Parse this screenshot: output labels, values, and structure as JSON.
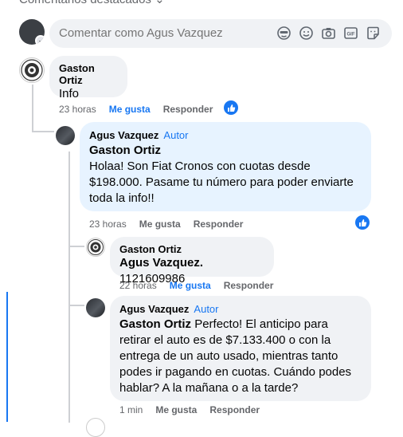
{
  "section": {
    "title": "Comentarios destacados"
  },
  "composer": {
    "placeholder": "Comentar como Agus Vazquez",
    "icons": [
      "avatar-sticker-icon",
      "emoji-icon",
      "camera-icon",
      "gif-icon",
      "sticker-icon"
    ]
  },
  "comments": [
    {
      "author": "Gaston Ortiz",
      "text": "Info",
      "time": "23 horas",
      "like": "Me gusta",
      "reply": "Responder",
      "avatar": "logo"
    },
    {
      "author": "Agus Vazquez",
      "author_tag": "Autor",
      "mention": "Gaston Ortiz",
      "text": "Holaa! Son Fiat Cronos con cuotas desde $198.000. Pasame tu número para poder enviarte toda la info!!",
      "time": "23 horas",
      "like": "Me gusta",
      "reply": "Responder",
      "avatar": "dark"
    },
    {
      "author": "Gaston Ortiz",
      "mention": "Agus Vazquez.",
      "text": "1121609986",
      "time": "22 horas",
      "like": "Me gusta",
      "reply": "Responder",
      "avatar": "logo"
    },
    {
      "author": "Agus Vazquez",
      "author_tag": "Autor",
      "mention": "Gaston Ortiz",
      "text": "Perfecto! El anticipo para retirar el auto es de $7.133.400 o con la entrega de un auto usado, mientras tanto podes ir pagando en cuotas. Cuándo podes hablar? A la mañana o a la tarde?",
      "time": "1 min",
      "like": "Me gusta",
      "reply": "Responder",
      "avatar": "dark"
    }
  ],
  "colors": {
    "accent": "#1877f2",
    "bubble": "#f0f2f5",
    "bubble_highlight": "#e7f3ff"
  }
}
